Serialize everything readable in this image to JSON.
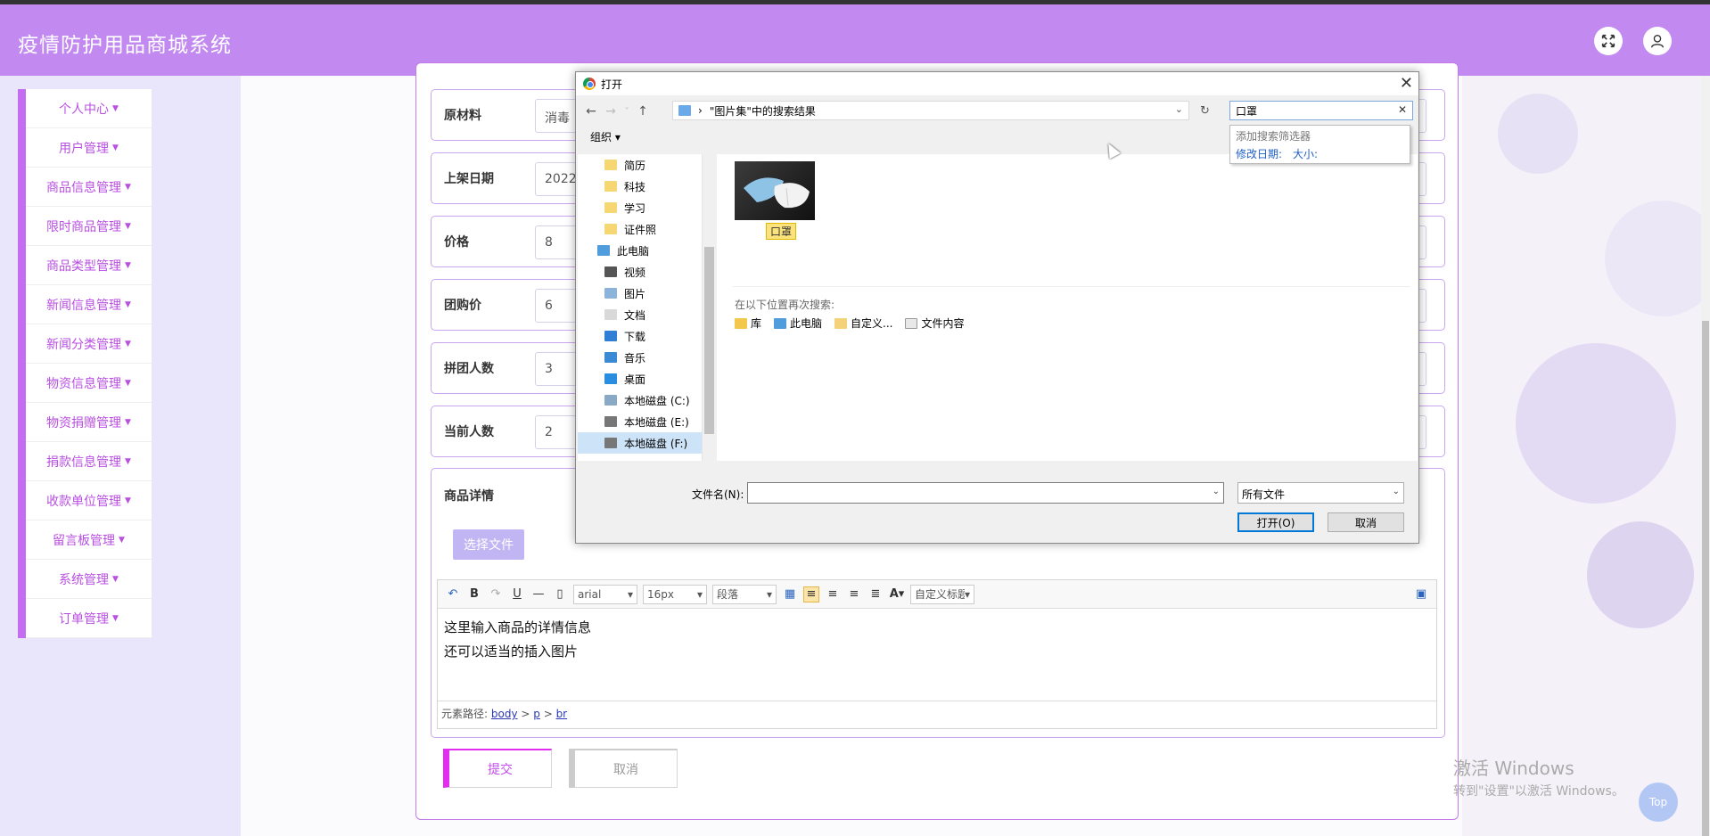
{
  "app": {
    "title": "疫情防护用品商城系统"
  },
  "header": {
    "fullscreen_icon": "expand-icon",
    "user_icon": "user-icon"
  },
  "sidebar": {
    "items": [
      {
        "label": "个人中心"
      },
      {
        "label": "用户管理"
      },
      {
        "label": "商品信息管理"
      },
      {
        "label": "限时商品管理"
      },
      {
        "label": "商品类型管理"
      },
      {
        "label": "新闻信息管理"
      },
      {
        "label": "新闻分类管理"
      },
      {
        "label": "物资信息管理"
      },
      {
        "label": "物资捐赠管理"
      },
      {
        "label": "捐款信息管理"
      },
      {
        "label": "收款单位管理"
      },
      {
        "label": "留言板管理"
      },
      {
        "label": "系统管理"
      },
      {
        "label": "订单管理"
      }
    ]
  },
  "form": {
    "rows": [
      {
        "label": "原材料",
        "value": "消毒"
      },
      {
        "label": "上架日期",
        "value": "2022"
      },
      {
        "label": "价格",
        "value": "8"
      },
      {
        "label": "团购价",
        "value": "6"
      },
      {
        "label": "拼团人数",
        "value": "3"
      },
      {
        "label": "当前人数",
        "value": "2"
      }
    ],
    "detail_label": "商品详情",
    "choose_file": "选择文件",
    "editor": {
      "font_family": "arial",
      "font_size": "16px",
      "paragraph": "段落",
      "custom_title": "自定义标题",
      "lines": [
        "这里输入商品的详情信息",
        "还可以适当的插入图片"
      ],
      "path_label": "元素路径:",
      "path": [
        "body",
        "p",
        "br"
      ]
    },
    "submit": "提交",
    "cancel": "取消"
  },
  "watermark": {
    "line1": "激活 Windows",
    "line2": "转到\"设置\"以激活 Windows。"
  },
  "top_button": "Top",
  "dialog": {
    "title": "打开",
    "address": "\"图片集\"中的搜索结果",
    "search_value": "口罩",
    "search_dropdown": {
      "title": "添加搜索筛选器",
      "filters": [
        "修改日期:",
        "大小:"
      ]
    },
    "organize": "组织",
    "nav_items": [
      "简历",
      "科技",
      "学习",
      "证件照",
      "此电脑",
      "视频",
      "图片",
      "文档",
      "下载",
      "音乐",
      "桌面",
      "本地磁盘 (C:)",
      "本地磁盘 (E:)",
      "本地磁盘 (F:)"
    ],
    "result_caption": "口罩",
    "search_again_label": "在以下位置再次搜索:",
    "search_again": [
      "库",
      "此电脑",
      "自定义...",
      "文件内容"
    ],
    "filename_label": "文件名(N):",
    "filename_value": "",
    "filetype": "所有文件",
    "open_btn": "打开(O)",
    "cancel_btn": "取消"
  },
  "colors": {
    "header": "#c289f0",
    "accent": "#c56df0",
    "row_border": "#c9a6ef"
  }
}
